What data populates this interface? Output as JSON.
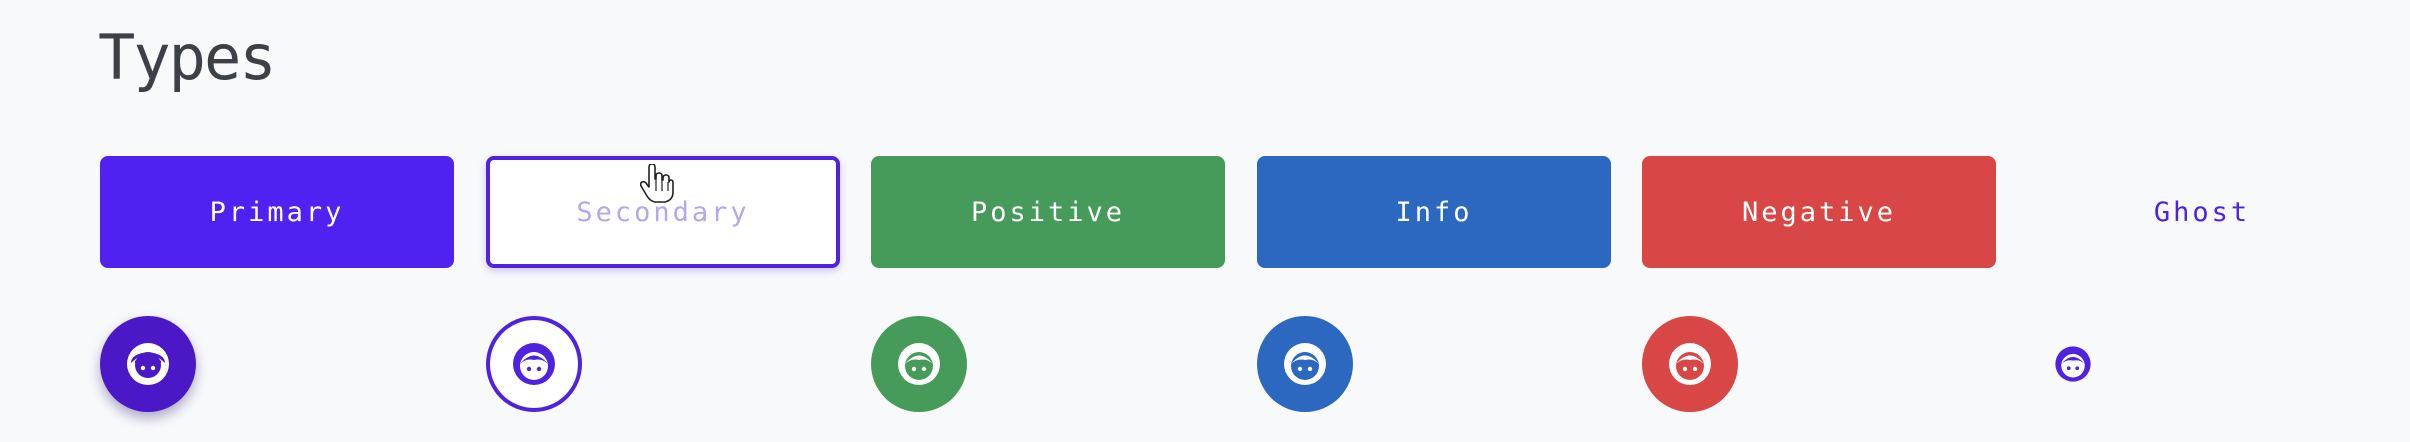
{
  "section": {
    "title": "Types"
  },
  "buttons": [
    {
      "label": "Primary"
    },
    {
      "label": "Secondary"
    },
    {
      "label": "Positive"
    },
    {
      "label": "Info"
    },
    {
      "label": "Negative"
    },
    {
      "label": "Ghost"
    }
  ],
  "icon_buttons": [
    {
      "icon": "face-icon",
      "variant": "primary"
    },
    {
      "icon": "face-icon",
      "variant": "secondary"
    },
    {
      "icon": "face-icon",
      "variant": "positive"
    },
    {
      "icon": "face-icon",
      "variant": "info"
    },
    {
      "icon": "face-icon",
      "variant": "negative"
    },
    {
      "icon": "face-icon",
      "variant": "ghost"
    }
  ],
  "colors": {
    "primary": "#4f22f2",
    "primary_dark": "#4a18c6",
    "positive": "#479b5a",
    "info": "#2c68bf",
    "negative": "#d84745",
    "secondary_text": "#b6a6ea",
    "ghost_text": "#4f22e0",
    "background": "#f8f9fb"
  }
}
